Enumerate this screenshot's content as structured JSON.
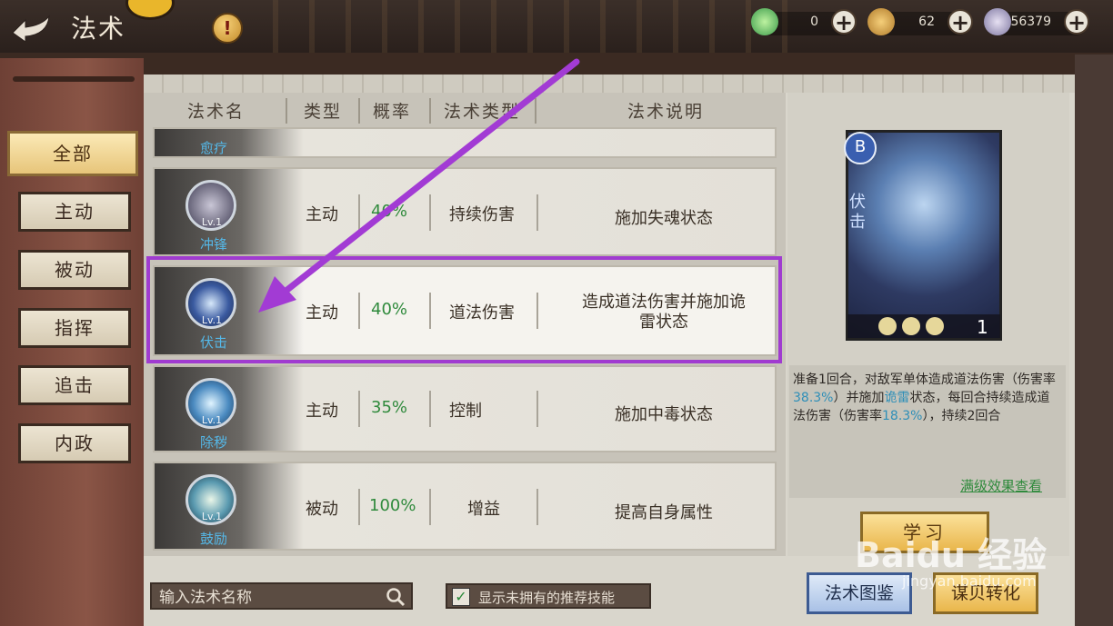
{
  "header": {
    "title": "法术",
    "resources": [
      {
        "icon": "jade-currency-icon",
        "value": "0"
      },
      {
        "icon": "copper-coin-icon",
        "value": "62"
      },
      {
        "icon": "silver-ingot-icon",
        "value": "56379"
      }
    ]
  },
  "sidebar": {
    "items": [
      {
        "label": "全部",
        "active": true
      },
      {
        "label": "主动"
      },
      {
        "label": "被动"
      },
      {
        "label": "指挥"
      },
      {
        "label": "追击"
      },
      {
        "label": "内政"
      }
    ]
  },
  "table": {
    "headers": [
      "法术名",
      "类型",
      "概率",
      "法术类型",
      "法术说明"
    ],
    "partial_row_name": "愈疗",
    "rows": [
      {
        "name": "冲锋",
        "level": "Lv.1",
        "type": "主动",
        "rate": "40%",
        "category": "持续伤害",
        "desc": "施加失魂状态"
      },
      {
        "name": "伏击",
        "level": "Lv.1",
        "type": "主动",
        "rate": "40%",
        "category": "道法伤害",
        "desc": "造成道法伤害并施加诡雷状态",
        "selected": true
      },
      {
        "name": "除秽",
        "level": "Lv.1",
        "type": "主动",
        "rate": "35%",
        "category": "控制",
        "desc": "施加中毒状态"
      },
      {
        "name": "鼓励",
        "level": "Lv.1",
        "type": "被动",
        "rate": "100%",
        "category": "增益",
        "desc": "提高自身属性"
      }
    ]
  },
  "detail": {
    "grade": "B",
    "name": "伏击",
    "count": "1",
    "desc_part1": "准备1回合，对敌军单体造成道法伤害（伤害率",
    "rate1": "38.3%",
    "desc_part2": "）并施加",
    "status": "诡雷",
    "desc_part3": "状态，每回合持续造成道法伤害（伤害率",
    "rate2": "18.3%",
    "desc_part4": "），持续2回合",
    "full_effect_link": "满级效果查看",
    "learn_label": "学习"
  },
  "bottom": {
    "search_placeholder": "输入法术名称",
    "recommend_label": "显示未拥有的推荐技能",
    "codex_label": "法术图鉴",
    "convert_label": "谋贝转化"
  },
  "watermark": {
    "brand": "Baidu 经验",
    "url": "jingyan.baidu.com"
  },
  "colors": {
    "highlight": "#a03bd0",
    "rate_green": "#2f8a3c",
    "skill_name_blue": "#55b8e8"
  }
}
